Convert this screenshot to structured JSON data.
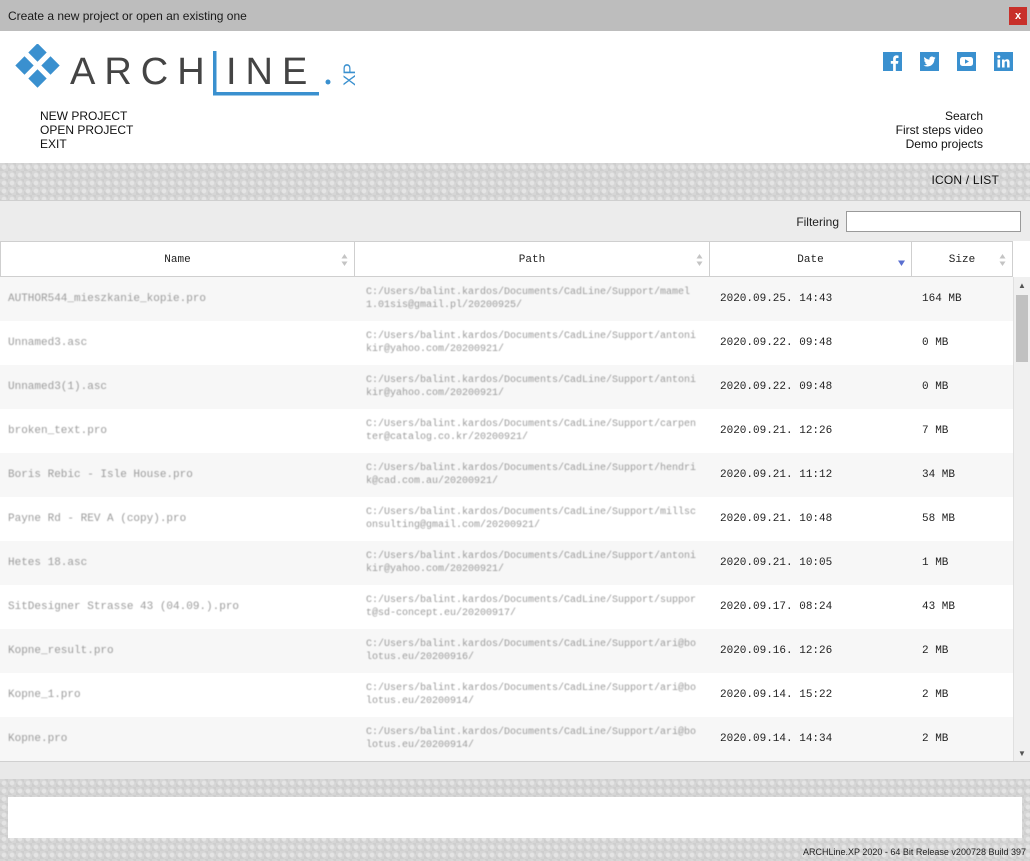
{
  "window": {
    "title": "Create a new project or open an existing one",
    "close_label": "x"
  },
  "brand": {
    "name": "ARCH",
    "name2": "INE",
    "suffix": "XP",
    "brand_color": "#3a90cf"
  },
  "social": [
    {
      "name": "facebook-icon"
    },
    {
      "name": "twitter-icon"
    },
    {
      "name": "youtube-icon"
    },
    {
      "name": "linkedin-icon"
    }
  ],
  "menu_left": [
    "NEW PROJECT",
    "OPEN PROJECT",
    "EXIT"
  ],
  "menu_right": [
    "Search",
    "First steps video",
    "Demo projects"
  ],
  "view_toggle": "ICON / LIST",
  "filter": {
    "label": "Filtering",
    "value": ""
  },
  "columns": {
    "name": "Name",
    "path": "Path",
    "date": "Date",
    "size": "Size"
  },
  "sort": {
    "column": "date",
    "direction": "descending",
    "color": "#5a6fd0"
  },
  "rows": [
    {
      "name": "AUTHOR544_mieszkanie_kopie.pro",
      "path": "C:/Users/balint.kardos/Documents/CadLine/Support/mamel1.01sis@gmail.pl/20200925/",
      "date": "2020.09.25. 14:43",
      "size": "164 MB"
    },
    {
      "name": "Unnamed3.asc",
      "path": "C:/Users/balint.kardos/Documents/CadLine/Support/antonikir@yahoo.com/20200921/",
      "date": "2020.09.22. 09:48",
      "size": "0 MB"
    },
    {
      "name": "Unnamed3(1).asc",
      "path": "C:/Users/balint.kardos/Documents/CadLine/Support/antonikir@yahoo.com/20200921/",
      "date": "2020.09.22. 09:48",
      "size": "0 MB"
    },
    {
      "name": "broken_text.pro",
      "path": "C:/Users/balint.kardos/Documents/CadLine/Support/carpenter@catalog.co.kr/20200921/",
      "date": "2020.09.21. 12:26",
      "size": "7 MB"
    },
    {
      "name": "Boris Rebic - Isle House.pro",
      "path": "C:/Users/balint.kardos/Documents/CadLine/Support/hendrik@cad.com.au/20200921/",
      "date": "2020.09.21. 11:12",
      "size": "34 MB"
    },
    {
      "name": "Payne Rd - REV A (copy).pro",
      "path": "C:/Users/balint.kardos/Documents/CadLine/Support/millsconsulting@gmail.com/20200921/",
      "date": "2020.09.21. 10:48",
      "size": "58 MB"
    },
    {
      "name": "Hetes 18.asc",
      "path": "C:/Users/balint.kardos/Documents/CadLine/Support/antonikir@yahoo.com/20200921/",
      "date": "2020.09.21. 10:05",
      "size": "1 MB"
    },
    {
      "name": "SitDesigner Strasse 43 (04.09.).pro",
      "path": "C:/Users/balint.kardos/Documents/CadLine/Support/support@sd-concept.eu/20200917/",
      "date": "2020.09.17. 08:24",
      "size": "43 MB"
    },
    {
      "name": "Kopne_result.pro",
      "path": "C:/Users/balint.kardos/Documents/CadLine/Support/ari@bolotus.eu/20200916/",
      "date": "2020.09.16. 12:26",
      "size": "2 MB"
    },
    {
      "name": "Kopne_1.pro",
      "path": "C:/Users/balint.kardos/Documents/CadLine/Support/ari@bolotus.eu/20200914/",
      "date": "2020.09.14. 15:22",
      "size": "2 MB"
    },
    {
      "name": "Kopne.pro",
      "path": "C:/Users/balint.kardos/Documents/CadLine/Support/ari@bolotus.eu/20200914/",
      "date": "2020.09.14. 14:34",
      "size": "2 MB"
    }
  ],
  "scrollbar": {
    "up": "▲",
    "down": "▼"
  },
  "footer": {
    "version": "ARCHLine.XP 2020 - 64 Bit Release v200728 Build 397"
  }
}
